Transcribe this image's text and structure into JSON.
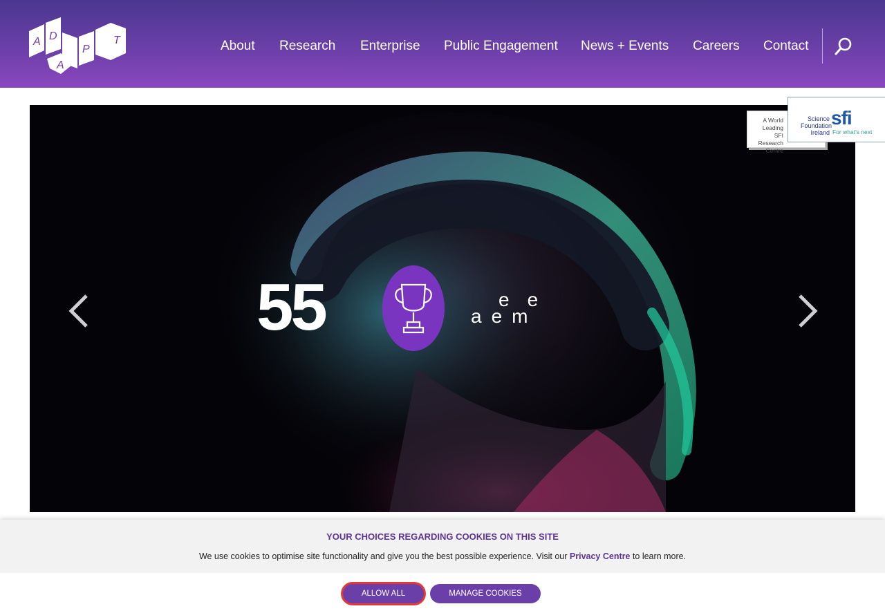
{
  "header": {
    "logo_letters": [
      "A",
      "D",
      "A",
      "P",
      "T"
    ],
    "nav": [
      {
        "label": "About"
      },
      {
        "label": "Research"
      },
      {
        "label": "Enterprise"
      },
      {
        "label": "Public Engagement"
      },
      {
        "label": "News + Events"
      },
      {
        "label": "Careers"
      },
      {
        "label": "Contact"
      }
    ],
    "search_icon": "search-icon",
    "gradient_colors": [
      "#4a3790",
      "#8a47c0"
    ]
  },
  "hero": {
    "big_number": "55",
    "badge_icon": "trophy-icon",
    "tagline_line1": "ee",
    "tagline_line2": "aem",
    "prev_icon": "chevron-left-icon",
    "next_icon": "chevron-right-icon"
  },
  "badges": {
    "world_leading_lines": [
      "A World",
      "Leading SFI",
      "Research",
      "Centre"
    ],
    "sfi_lines": [
      "Science",
      "Foundation",
      "Ireland"
    ],
    "sfi_mark": "sfi",
    "sfi_tagline": "For what's next"
  },
  "cookie_banner": {
    "title": "YOUR CHOICES REGARDING COOKIES ON THIS SITE",
    "text_before": "We use cookies to optimise site functionality and give you the best possible experience. Visit our ",
    "link": "Privacy Centre",
    "text_after": " to learn more.",
    "allow_all": "ALLOW ALL",
    "manage": "MANAGE COOKIES",
    "accent_color": "#6b3fa8"
  }
}
